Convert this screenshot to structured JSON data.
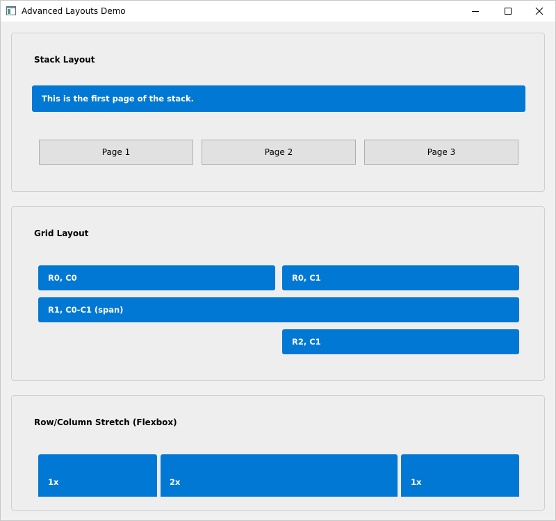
{
  "window": {
    "title": "Advanced Layouts Demo"
  },
  "stack_group": {
    "title": "Stack Layout",
    "current_page_text": "This is the first page of the stack.",
    "buttons": [
      "Page 1",
      "Page 2",
      "Page 3"
    ]
  },
  "grid_group": {
    "title": "Grid Layout",
    "cells": {
      "r0c0": "R0, C0",
      "r0c1": "R0, C1",
      "r1span": "R1, C0-C1 (span)",
      "r2c1": "R2, C1"
    }
  },
  "stretch_group": {
    "title": "Row/Column Stretch (Flexbox)",
    "items": [
      "1x",
      "2x",
      "1x"
    ]
  },
  "colors": {
    "accent": "#0078d4",
    "button_bg": "#e1e1e1",
    "window_bg": "#f0f0f0"
  },
  "icons": {
    "app": "app-window-icon",
    "minimize": "minimize-icon",
    "maximize": "maximize-icon",
    "close": "close-icon"
  }
}
